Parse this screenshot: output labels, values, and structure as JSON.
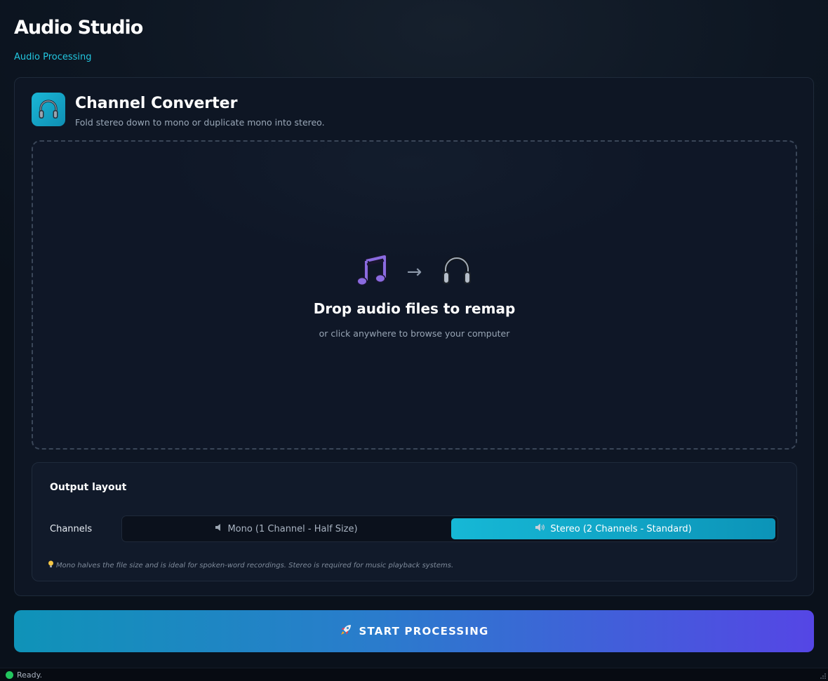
{
  "app": {
    "title": "Audio Studio",
    "subtitle": "Audio Processing"
  },
  "tool": {
    "title": "Channel Converter",
    "description": "Fold stereo down to mono or duplicate mono into stereo.",
    "icon": "headphones-icon"
  },
  "dropzone": {
    "title": "Drop audio files to remap",
    "subtitle": "or click anywhere to browse your computer",
    "icons": [
      "music-note-icon",
      "arrow-right-icon",
      "headphones-icon"
    ],
    "arrow": "→"
  },
  "settings": {
    "title": "Output layout",
    "channels_label": "Channels",
    "options": [
      {
        "label": "Mono (1 Channel - Half Size)",
        "icon": "speaker-low-icon",
        "selected": false
      },
      {
        "label": "Stereo (2 Channels - Standard)",
        "icon": "speaker-high-icon",
        "selected": true
      }
    ],
    "hint": "Mono halves the file size and is ideal for spoken-word recordings. Stereo is required for music playback systems.",
    "hint_icon": "lightbulb-icon"
  },
  "action": {
    "label": "START PROCESSING",
    "icon": "rocket-icon"
  },
  "status": {
    "text": "Ready.",
    "color": "#22c55e"
  },
  "colors": {
    "accent": "#16b8d6",
    "gradient_end": "#5546e5",
    "subtitle": "#22c7e0"
  }
}
